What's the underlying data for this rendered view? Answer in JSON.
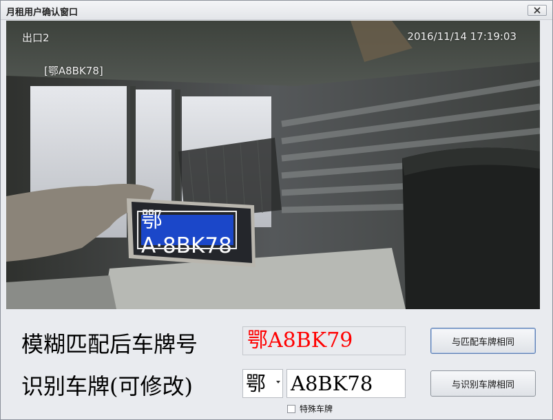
{
  "window": {
    "title": "月租用户确认窗口",
    "close_icon": "close-icon"
  },
  "camera": {
    "camera_name": "出口2",
    "timestamp": "2016/11/14  17:19:03",
    "recognized_plate_overlay": "[鄂A8BK78]",
    "plate_in_image": "鄂A·8BK78",
    "plate_color": "#1b47c9"
  },
  "form": {
    "fuzzy_label": "模糊匹配后车牌号",
    "matched_plate": "鄂A8BK79",
    "matched_plate_color": "#ff0000",
    "recognized_label": "识别车牌(可修改)",
    "province": "鄂",
    "plate_number": "A8BK78",
    "special_plate_label": "特殊车牌",
    "special_plate_checked": false
  },
  "buttons": {
    "same_as_matched": "与匹配车牌相同",
    "same_as_recognized": "与识别车牌相同"
  }
}
